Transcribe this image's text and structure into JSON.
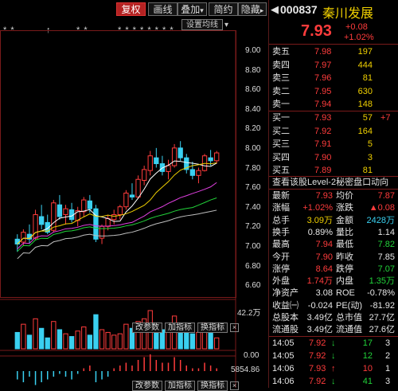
{
  "toolbar": {
    "buttons": [
      "复权",
      "画线",
      "叠加",
      "简约",
      "隐藏"
    ],
    "overlay_arrow": "▾",
    "hide_arrow": "▸"
  },
  "chart": {
    "set_ma_label": "设置均线",
    "star_marks": [
      "* *",
      "↑",
      "* *",
      "* *",
      "* * * * * * * *",
      "↕"
    ],
    "y_labels": [
      "9.00",
      "8.80",
      "8.60",
      "8.40",
      "8.20",
      "8.00",
      "7.80",
      "7.60",
      "7.40",
      "7.20",
      "7.00",
      "6.80",
      "6.60"
    ],
    "vol_labels": [
      "42.2万",
      "0.00"
    ],
    "macd_label": "5854.86",
    "sub_buttons": [
      "改参数",
      "加指标",
      "换指标"
    ],
    "close_symbol": "×",
    "colors": {
      "up": "#ff3c3c",
      "down": "#3ad0f0",
      "ma5": "#ffffff",
      "ma10": "#f0d000",
      "ma20": "#e040e0",
      "ma30": "#22d33a",
      "ma60": "#bfbfbf"
    }
  },
  "chart_data": {
    "type": "candlestick",
    "ylim": [
      6.5,
      9.1
    ],
    "candles": [
      [
        7.05,
        7.1,
        6.92,
        7.0
      ],
      [
        7.02,
        7.15,
        6.98,
        7.12
      ],
      [
        7.1,
        7.2,
        7.0,
        7.05
      ],
      [
        7.06,
        7.35,
        7.04,
        7.3
      ],
      [
        7.28,
        7.4,
        7.15,
        7.2
      ],
      [
        7.22,
        7.3,
        7.1,
        7.12
      ],
      [
        7.14,
        7.45,
        7.12,
        7.42
      ],
      [
        7.4,
        7.5,
        7.25,
        7.28
      ],
      [
        7.3,
        7.4,
        7.2,
        7.36
      ],
      [
        7.35,
        7.42,
        7.22,
        7.25
      ],
      [
        7.24,
        7.38,
        7.18,
        7.34
      ],
      [
        7.33,
        7.48,
        7.28,
        7.45
      ],
      [
        7.44,
        7.5,
        7.32,
        7.36
      ],
      [
        7.36,
        7.4,
        7.02,
        7.05
      ],
      [
        7.06,
        7.2,
        7.0,
        7.18
      ],
      [
        7.18,
        7.3,
        7.14,
        7.26
      ],
      [
        7.25,
        7.35,
        7.2,
        7.3
      ],
      [
        7.3,
        7.4,
        7.25,
        7.38
      ],
      [
        7.38,
        7.55,
        7.35,
        7.52
      ],
      [
        7.5,
        7.62,
        7.45,
        7.48
      ],
      [
        7.48,
        7.7,
        7.46,
        7.66
      ],
      [
        7.65,
        7.8,
        7.6,
        7.76
      ],
      [
        7.75,
        7.95,
        7.7,
        7.9
      ],
      [
        7.88,
        7.98,
        7.78,
        7.82
      ],
      [
        7.82,
        7.9,
        7.7,
        7.74
      ],
      [
        7.74,
        7.86,
        7.66,
        7.8
      ],
      [
        7.8,
        8.02,
        7.78,
        7.98
      ],
      [
        7.98,
        8.05,
        7.85,
        7.88
      ],
      [
        7.88,
        7.92,
        7.72,
        7.76
      ],
      [
        7.76,
        7.84,
        7.66,
        7.7
      ],
      [
        7.7,
        7.78,
        7.62,
        7.75
      ],
      [
        7.75,
        7.92,
        7.74,
        7.9
      ],
      [
        7.88,
        7.96,
        7.8,
        7.85
      ],
      [
        7.85,
        7.95,
        7.82,
        7.93
      ]
    ],
    "volumes": [
      12,
      18,
      10,
      22,
      15,
      8,
      20,
      14,
      11,
      9,
      13,
      16,
      10,
      25,
      14,
      12,
      10,
      11,
      18,
      15,
      20,
      22,
      28,
      18,
      14,
      16,
      24,
      17,
      13,
      11,
      12,
      19,
      14,
      8
    ],
    "macd": [
      -3,
      -4,
      -2,
      -5,
      -4,
      -3,
      -2,
      -1,
      -2,
      -3,
      -1,
      1,
      2,
      -4,
      -3,
      -2,
      1,
      2,
      3,
      2,
      4,
      5,
      6,
      4,
      3,
      3,
      5,
      4,
      2,
      1,
      1,
      3,
      2,
      1
    ]
  },
  "quote": {
    "code": "000837",
    "name": "秦川发展",
    "price": "7.93",
    "change": "+0.08",
    "change_pct": "+1.02%"
  },
  "order_book": {
    "asks": [
      {
        "label": "卖五",
        "price": "7.98",
        "vol": "197",
        "chg": ""
      },
      {
        "label": "卖四",
        "price": "7.97",
        "vol": "444",
        "chg": ""
      },
      {
        "label": "卖三",
        "price": "7.96",
        "vol": "81",
        "chg": ""
      },
      {
        "label": "卖二",
        "price": "7.95",
        "vol": "630",
        "chg": ""
      },
      {
        "label": "卖一",
        "price": "7.94",
        "vol": "148",
        "chg": ""
      }
    ],
    "bids": [
      {
        "label": "买一",
        "price": "7.93",
        "vol": "57",
        "chg": "+7"
      },
      {
        "label": "买二",
        "price": "7.92",
        "vol": "164",
        "chg": ""
      },
      {
        "label": "买三",
        "price": "7.91",
        "vol": "5",
        "chg": ""
      },
      {
        "label": "买四",
        "price": "7.90",
        "vol": "3",
        "chg": ""
      },
      {
        "label": "买五",
        "price": "7.89",
        "vol": "81",
        "chg": ""
      }
    ]
  },
  "l2_link": "查看该股Level-2秘密盘口动向",
  "stats": [
    {
      "l1": "最新",
      "v1": "7.93",
      "c1": "red",
      "l2": "均价",
      "v2": "7.87",
      "c2": "red"
    },
    {
      "l1": "涨幅",
      "v1": "+1.02%",
      "c1": "red",
      "l2": "涨跌",
      "v2": "▲0.08",
      "c2": "red"
    },
    {
      "l1": "总手",
      "v1": "3.09万",
      "c1": "yellow",
      "l2": "金额",
      "v2": "2428万",
      "c2": "cyan"
    },
    {
      "l1": "换手",
      "v1": "0.89%",
      "c1": "white",
      "l2": "量比",
      "v2": "1.14",
      "c2": "white"
    },
    {
      "l1": "最高",
      "v1": "7.94",
      "c1": "red",
      "l2": "最低",
      "v2": "7.82",
      "c2": "green"
    },
    {
      "l1": "今开",
      "v1": "7.90",
      "c1": "red",
      "l2": "昨收",
      "v2": "7.85",
      "c2": "white"
    },
    {
      "l1": "涨停",
      "v1": "8.64",
      "c1": "red",
      "l2": "跌停",
      "v2": "7.07",
      "c2": "green"
    },
    {
      "l1": "外盘",
      "v1": "1.74万",
      "c1": "red",
      "l2": "内盘",
      "v2": "1.35万",
      "c2": "green"
    },
    {
      "l1": "净资产",
      "v1": "3.08",
      "c1": "white",
      "l2": "ROE",
      "v2": "-0.78%",
      "c2": "white"
    },
    {
      "l1": "收益㈠",
      "v1": "-0.024",
      "c1": "white",
      "l2": "PE(动)",
      "v2": "-81.92",
      "c2": "white"
    },
    {
      "l1": "总股本",
      "v1": "3.49亿",
      "c1": "white",
      "l2": "总市值",
      "v2": "27.7亿",
      "c2": "white"
    },
    {
      "l1": "流通股",
      "v1": "3.49亿",
      "c1": "white",
      "l2": "流通值",
      "v2": "27.6亿",
      "c2": "white"
    }
  ],
  "ticks": [
    {
      "time": "14:05",
      "price": "7.92",
      "arrow": "↓",
      "vol": "17",
      "n": "3"
    },
    {
      "time": "14:05",
      "price": "7.92",
      "arrow": "↓",
      "vol": "12",
      "n": "2"
    },
    {
      "time": "14:06",
      "price": "7.93",
      "arrow": "↑",
      "vol": "10",
      "n": "1"
    },
    {
      "time": "14:06",
      "price": "7.92",
      "arrow": "↓",
      "vol": "41",
      "n": "3"
    }
  ]
}
